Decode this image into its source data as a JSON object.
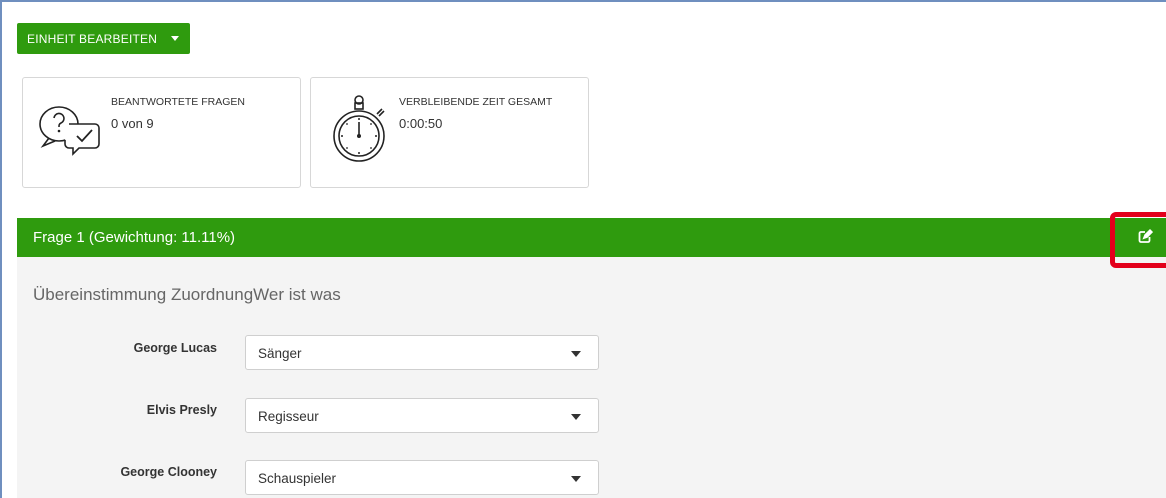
{
  "toolbar": {
    "edit_label": "EINHEIT BEARBEITEN"
  },
  "stats": [
    {
      "icon": "chat-question-check-icon",
      "title": "BEANTWORTETE FRAGEN",
      "value": "0 von 9"
    },
    {
      "icon": "stopwatch-icon",
      "title": "VERBLEIBENDE ZEIT GESAMT",
      "value": "0:00:50"
    }
  ],
  "question": {
    "header": "Frage 1 (Gewichtung: 11.11%)",
    "text": "Übereinstimmung ZuordnungWer ist was",
    "rows": [
      {
        "label": "George Lucas",
        "selected": "Sänger"
      },
      {
        "label": "Elvis Presly",
        "selected": "Regisseur"
      },
      {
        "label": "George Clooney",
        "selected": "Schauspieler"
      }
    ]
  },
  "colors": {
    "accent": "#2f9b0e",
    "highlight": "#e3001b",
    "body_bg": "#f4f4f4"
  }
}
